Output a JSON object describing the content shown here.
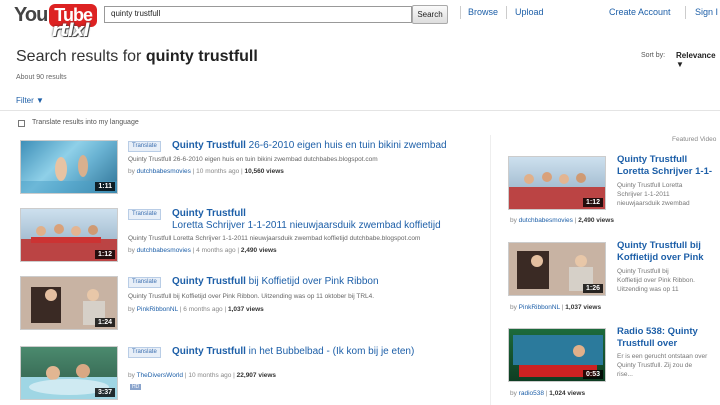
{
  "header": {
    "logo_you": "You",
    "logo_tube": "Tube",
    "watermark": "rtlxl",
    "search_value": "quinty trustfull",
    "search_button": "Search",
    "nav": [
      "Browse",
      "Upload",
      "Create Account",
      "Sign I"
    ]
  },
  "results_header": {
    "prefix": "Search results for ",
    "query": "quinty trustfull",
    "count": "About 90 results",
    "sort_label": "Sort by:",
    "sort_value": "Relevance ▼",
    "filter": "Filter ▼",
    "translate_lang": "Translate results into my language"
  },
  "results": [
    {
      "translate": "Translate",
      "title_bold": "Quinty Trustfull",
      "title_rest": " 26-6-2010 eigen huis en tuin bikini zwembad",
      "title_line2": "",
      "desc": "Quinty Trustfull 26-6-2010 eigen huis en tuin bikini zwembad dutchbabes.blogspot.com",
      "meta_by": "by ",
      "user": "dutchbabesmovies",
      "meta_mid": " | 10 months ago | ",
      "views": "10,560 views",
      "duration": "1:11"
    },
    {
      "translate": "Translate",
      "title_bold": "Quinty Trustfull",
      "title_rest": "",
      "title_line2": "Loretta Schrijver 1-1-2011 nieuwjaarsduik zwembad koffietijd",
      "desc": "Quinty Trustfull Loretta Schrijver 1-1-2011 nieuwjaarsduik zwembad koffietijd dutchbabe.blogspot.com",
      "meta_by": "by ",
      "user": "dutchbabesmovies",
      "meta_mid": " | 4 months ago | ",
      "views": "2,490 views",
      "duration": "1:12"
    },
    {
      "translate": "Translate",
      "title_bold": "Quinty Trustfull",
      "title_rest": " bij Koffietijd over Pink Ribbon",
      "title_line2": "",
      "desc": "Quinty Trustfull bij Koffietijd over Pink Ribbon. Uitzending was op 11 oktober bij TRL4.",
      "meta_by": "by ",
      "user": "PinkRibbonNL",
      "meta_mid": " | 6 months ago | ",
      "views": "1,037 views",
      "duration": "1:24"
    },
    {
      "translate": "Translate",
      "title_bold": "Quinty Trustfull",
      "title_rest": " in het Bubbelbad - (Ik kom bij je eten)",
      "title_line2": "",
      "desc": "",
      "meta_by": "by ",
      "user": "TheDiversWorld",
      "meta_mid": " | 10 months ago | ",
      "views": "22,907 views",
      "duration": "3:37",
      "badge": "HD"
    }
  ],
  "sidebar": {
    "featured": "Featured Video",
    "items": [
      {
        "title1": "Quinty Trustfull",
        "title2": "Loretta Schrijver 1-1-",
        "desc1": "Quinty Trustfull Loretta",
        "desc2": "Schrijver 1-1-2011",
        "desc3": "nieuwjaarsduik zwembad",
        "user": "dutchbabesmovies",
        "views": "2,490 views",
        "duration": "1:12"
      },
      {
        "title1": "Quinty Trustfull bij",
        "title2": "Koffietijd over Pink",
        "desc1": "Quinty Trustfull bij",
        "desc2": "Koffietijd over Pink Ribbon.",
        "desc3": "Uitzending was op 11",
        "user": "PinkRibbonNL",
        "views": "1,037 views",
        "duration": "1:26"
      },
      {
        "title1": "Radio 538: Quinty",
        "title2": "Trustfull over",
        "desc1": "Er is een gerucht ontstaan over",
        "desc2": "Quinty Trustfull. Zij zou de",
        "desc3": "rise...",
        "user": "radio538",
        "views": "1,024 views",
        "duration": "0:53"
      }
    ]
  },
  "colors": {
    "link": "#1d5fa8",
    "logo_red": "#dd2222"
  }
}
